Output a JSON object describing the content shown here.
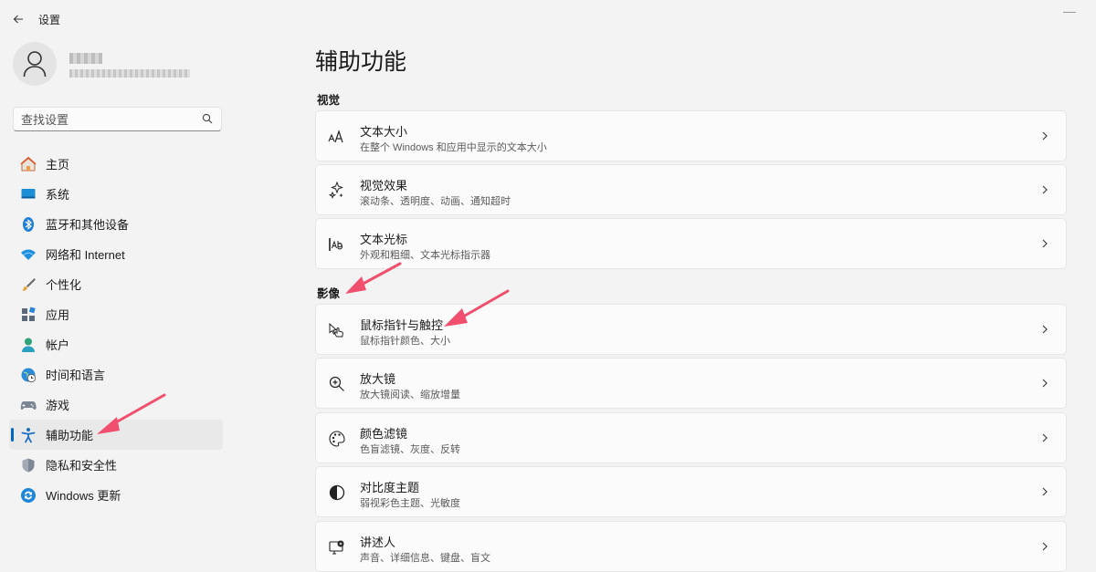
{
  "app": {
    "title": "设置"
  },
  "search": {
    "placeholder": "查找设置"
  },
  "sidebar": {
    "items": [
      {
        "label": "主页",
        "icon": "home-icon"
      },
      {
        "label": "系统",
        "icon": "system-icon"
      },
      {
        "label": "蓝牙和其他设备",
        "icon": "bluetooth-icon"
      },
      {
        "label": "网络和 Internet",
        "icon": "wifi-icon"
      },
      {
        "label": "个性化",
        "icon": "brush-icon"
      },
      {
        "label": "应用",
        "icon": "apps-icon"
      },
      {
        "label": "帐户",
        "icon": "account-icon"
      },
      {
        "label": "时间和语言",
        "icon": "globe-clock-icon"
      },
      {
        "label": "游戏",
        "icon": "gamepad-icon"
      },
      {
        "label": "辅助功能",
        "icon": "accessibility-icon",
        "active": true
      },
      {
        "label": "隐私和安全性",
        "icon": "shield-icon"
      },
      {
        "label": "Windows 更新",
        "icon": "update-icon"
      }
    ]
  },
  "main": {
    "title": "辅助功能",
    "sections": [
      {
        "label": "视觉",
        "cards": [
          {
            "title": "文本大小",
            "subtitle": "在整个 Windows 和应用中显示的文本大小",
            "icon": "text-size-icon"
          },
          {
            "title": "视觉效果",
            "subtitle": "滚动条、透明度、动画、通知超时",
            "icon": "sparkle-icon"
          },
          {
            "title": "文本光标",
            "subtitle": "外观和粗细、文本光标指示器",
            "icon": "text-cursor-icon"
          }
        ]
      },
      {
        "label": "影像",
        "cards": [
          {
            "title": "鼠标指针与触控",
            "subtitle": "鼠标指针颜色、大小",
            "icon": "pointer-touch-icon"
          },
          {
            "title": "放大镜",
            "subtitle": "放大镜阅读、缩放增量",
            "icon": "magnifier-icon"
          },
          {
            "title": "颜色滤镜",
            "subtitle": "色盲滤镜、灰度、反转",
            "icon": "palette-icon"
          },
          {
            "title": "对比度主题",
            "subtitle": "弱视彩色主题、光敏度",
            "icon": "contrast-icon"
          },
          {
            "title": "讲述人",
            "subtitle": "声音、详细信息、键盘、盲文",
            "icon": "narrator-icon"
          }
        ]
      }
    ]
  },
  "colors": {
    "accent": "#0067c0",
    "annotation_arrow": "#f0506e"
  }
}
